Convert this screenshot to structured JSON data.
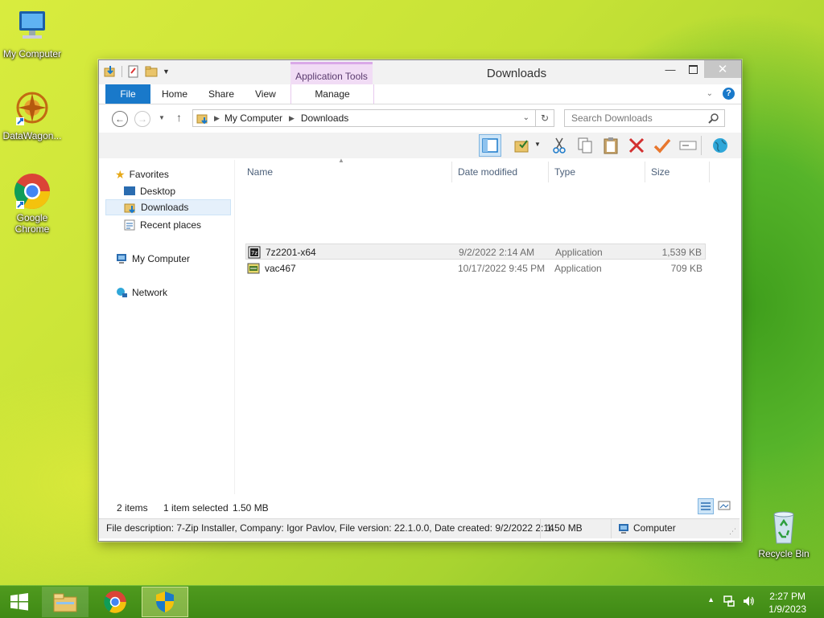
{
  "desktop": {
    "icons": [
      {
        "label": "My Computer"
      },
      {
        "label": "DataWagon..."
      },
      {
        "label": "Google Chrome"
      },
      {
        "label": "Recycle Bin"
      }
    ]
  },
  "window": {
    "title": "Downloads",
    "context_tab": "Application Tools",
    "ribbon_tabs": [
      "File",
      "Home",
      "Share",
      "View",
      "Manage"
    ],
    "address": {
      "crumbs": [
        "My Computer",
        "Downloads"
      ]
    },
    "search": {
      "placeholder": "Search Downloads"
    },
    "nav": {
      "favorites": "Favorites",
      "desktop": "Desktop",
      "downloads": "Downloads",
      "recent": "Recent places",
      "computer": "My Computer",
      "network": "Network"
    },
    "columns": [
      "Name",
      "Date modified",
      "Type",
      "Size"
    ],
    "files": [
      {
        "name": "7z2201-x64",
        "date": "9/2/2022 2:14 AM",
        "type": "Application",
        "size": "1,539 KB",
        "selected": true
      },
      {
        "name": "vac467",
        "date": "10/17/2022 9:45 PM",
        "type": "Application",
        "size": "709 KB",
        "selected": false
      }
    ],
    "status": {
      "items": "2 items",
      "selected": "1 item selected",
      "selected_size": "1.50 MB"
    },
    "infobar": {
      "description": "File description: 7-Zip Installer, Company: Igor Pavlov, File version: 22.1.0.0, Date created: 9/2/2022 2:14",
      "size": "1.50 MB",
      "location": "Computer"
    }
  },
  "taskbar": {
    "time": "2:27 PM",
    "date": "1/9/2023"
  },
  "colors": {
    "accent": "#1979ca",
    "context_tab": "#f1dcf5",
    "taskbar": "#4f9a1e"
  }
}
